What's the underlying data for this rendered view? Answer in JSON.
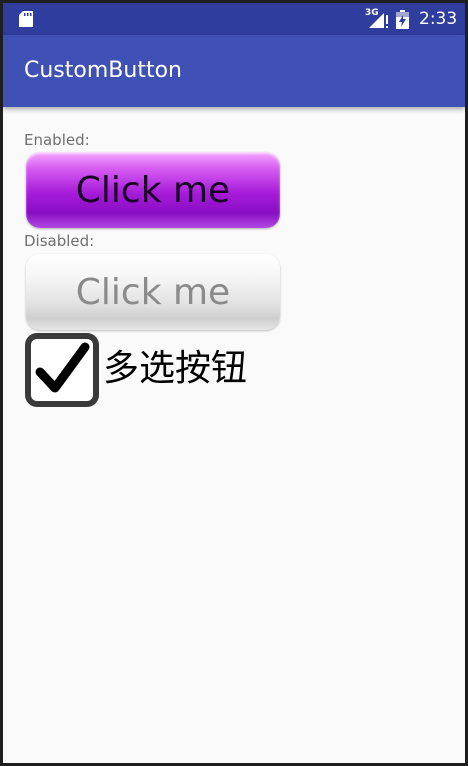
{
  "status_bar": {
    "network": "3G",
    "time": "2:33",
    "icons": [
      "sd-card-icon",
      "signal-icon",
      "battery-icon"
    ]
  },
  "app_bar": {
    "title": "CustomButton"
  },
  "content": {
    "enabled_label": "Enabled:",
    "enabled_button": "Click me",
    "disabled_label": "Disabled:",
    "disabled_button": "Click me",
    "checkbox": {
      "label": "多选按钮",
      "checked": true
    }
  },
  "colors": {
    "status_bar": "#2f3e9e",
    "app_bar": "#3f51b5",
    "background": "#fafafa",
    "enabled_button": "#a51ad8",
    "disabled_button": "#e2e2e2"
  }
}
